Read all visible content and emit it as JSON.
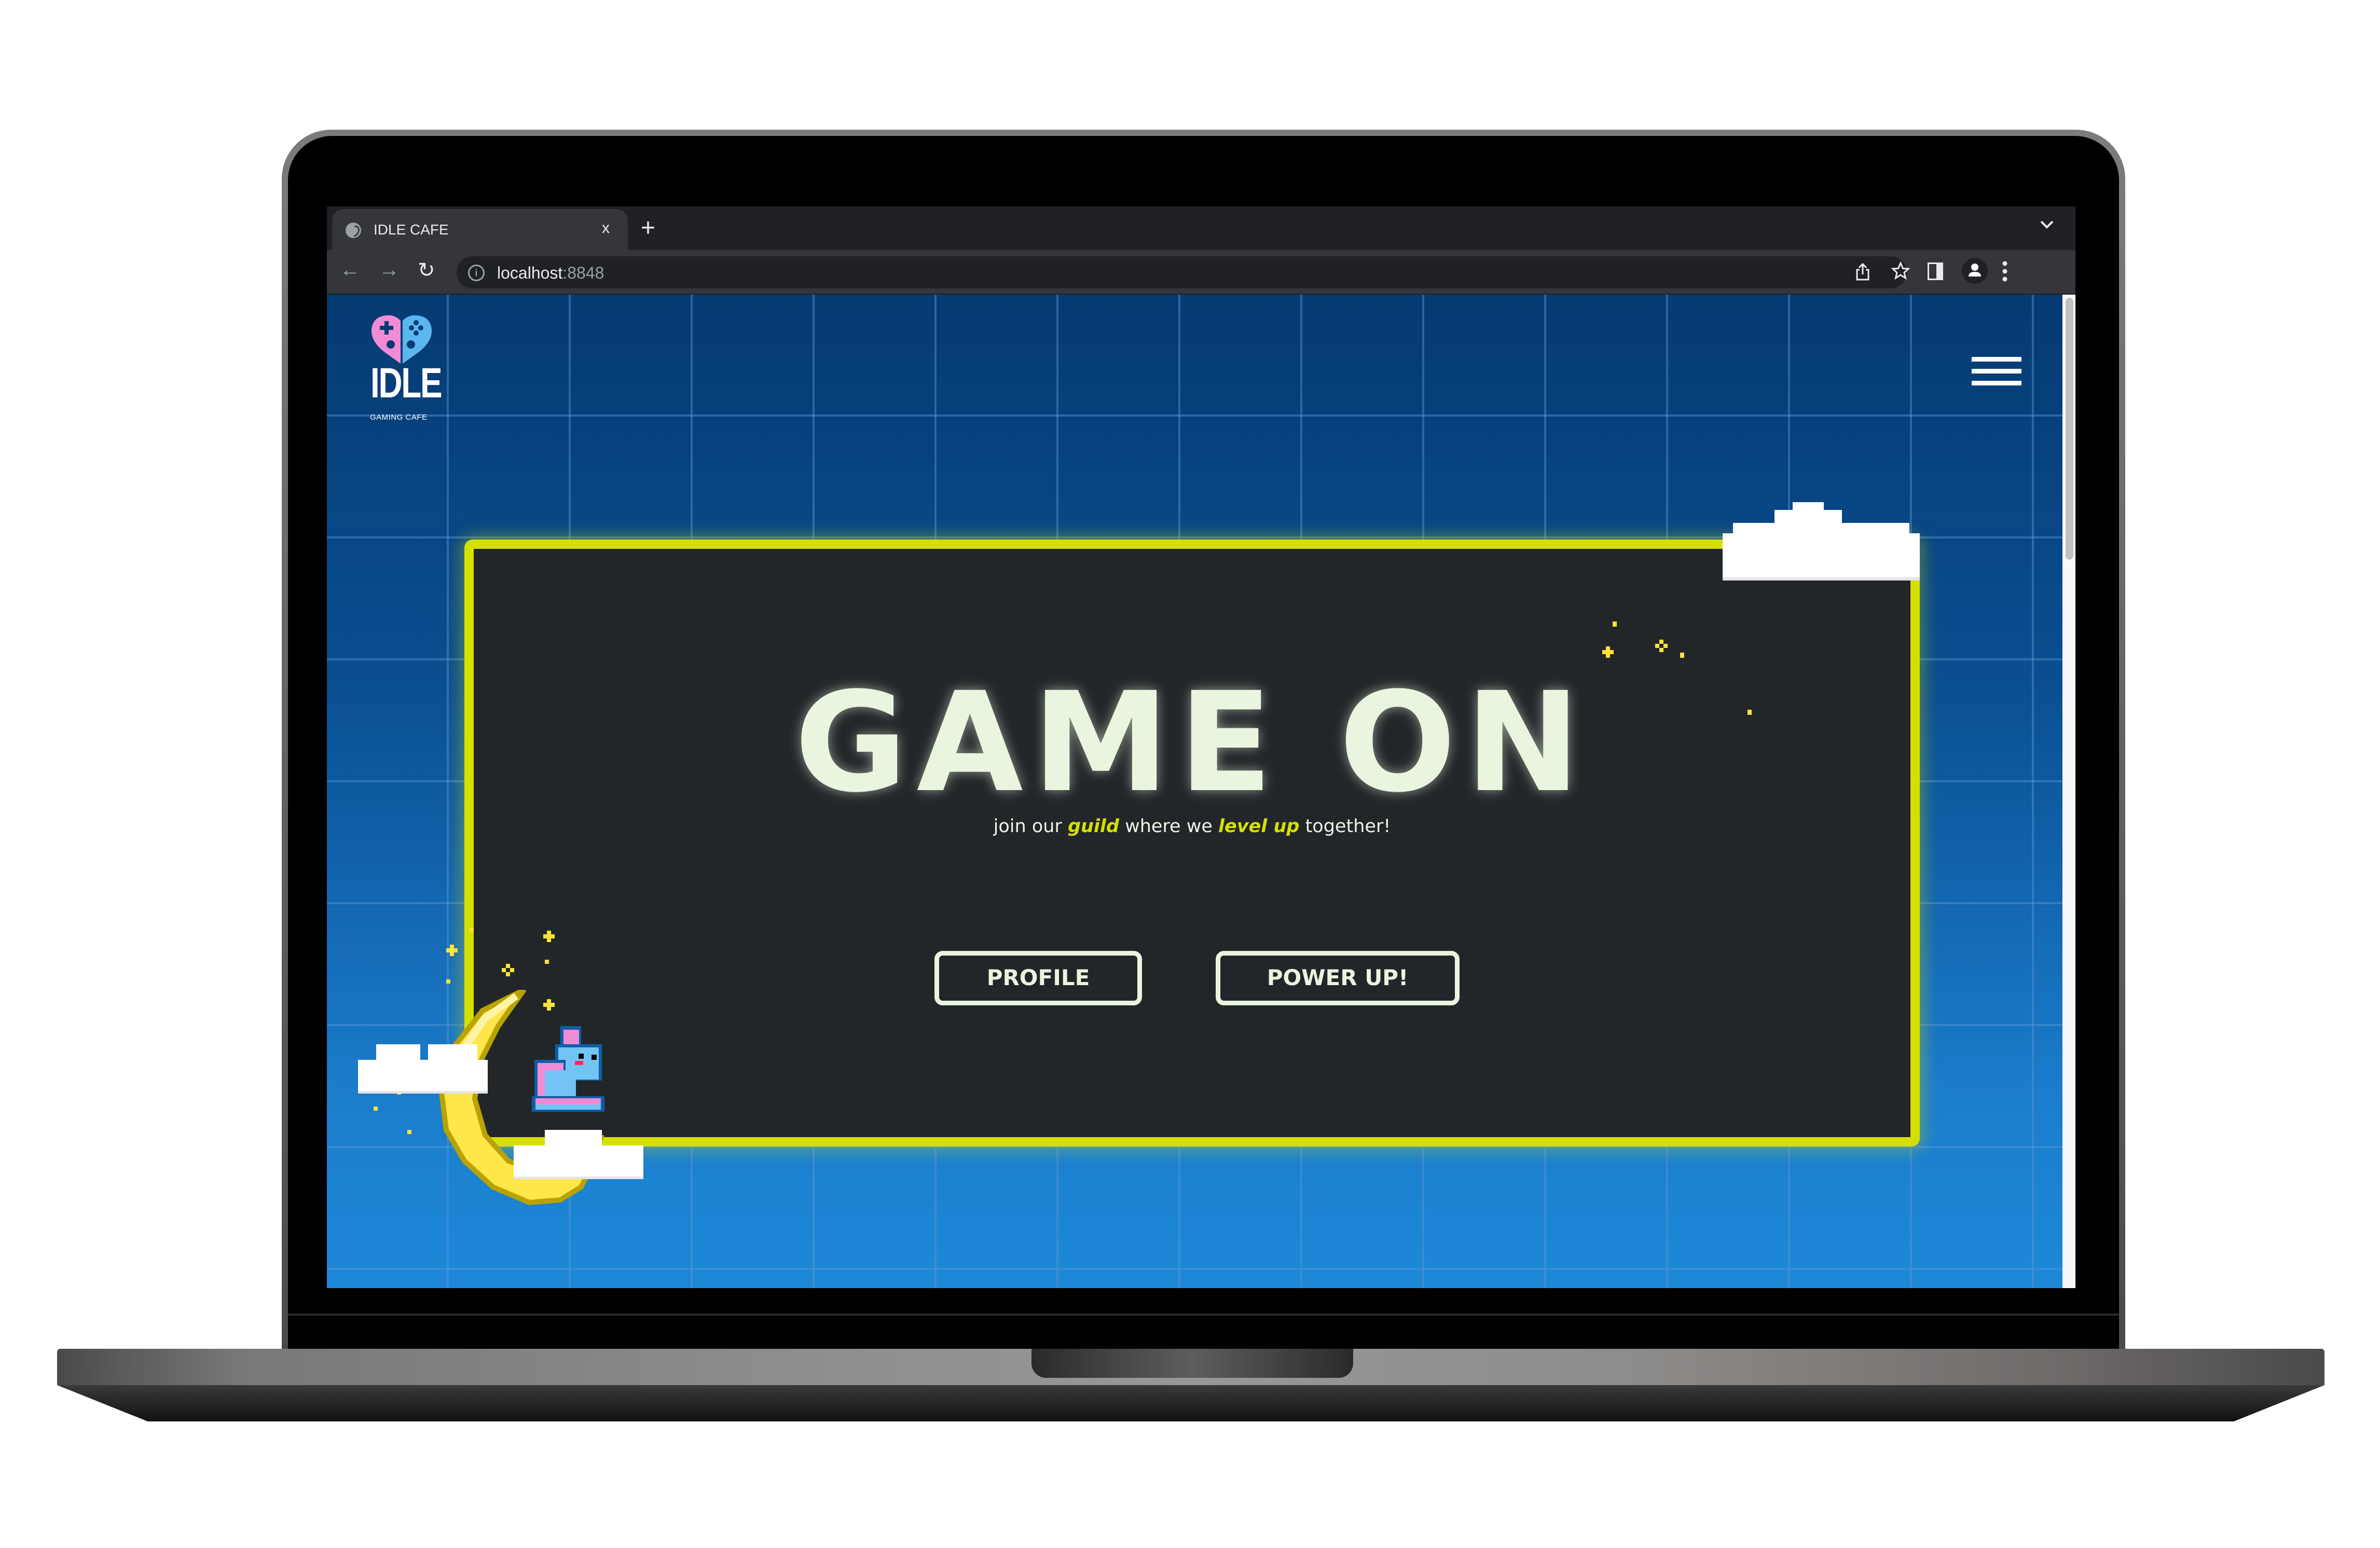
{
  "browser": {
    "tab_title": "IDLE CAFE",
    "tab_close": "x",
    "new_tab": "+",
    "tab_menu": "⌄",
    "url_host": "localhost",
    "url_port": ":8848",
    "nav": {
      "back": "←",
      "forward": "→",
      "reload": "↻"
    },
    "toolbar_icons": [
      "share-icon",
      "bookmark-star-icon",
      "side-panel-icon",
      "profile-icon",
      "more-menu-icon"
    ]
  },
  "site": {
    "logo": {
      "word": "IDLE",
      "sub": "GAMING CAFE"
    },
    "headline": "GAME ON",
    "tagline": {
      "pre": "join our ",
      "hl1": "guild",
      "mid": " where we ",
      "hl2": "level up",
      "post": " together!"
    },
    "buttons": {
      "profile": "PROFILE",
      "power_up": "POWER UP!"
    }
  },
  "colors": {
    "accent": "#d4e000",
    "panel_bg": "#232629",
    "text_light": "#e9f5df",
    "bg_top": "#053a72",
    "bg_bottom": "#1d88d8",
    "logo_pink": "#f08cd6",
    "logo_blue": "#5ab6ee"
  }
}
